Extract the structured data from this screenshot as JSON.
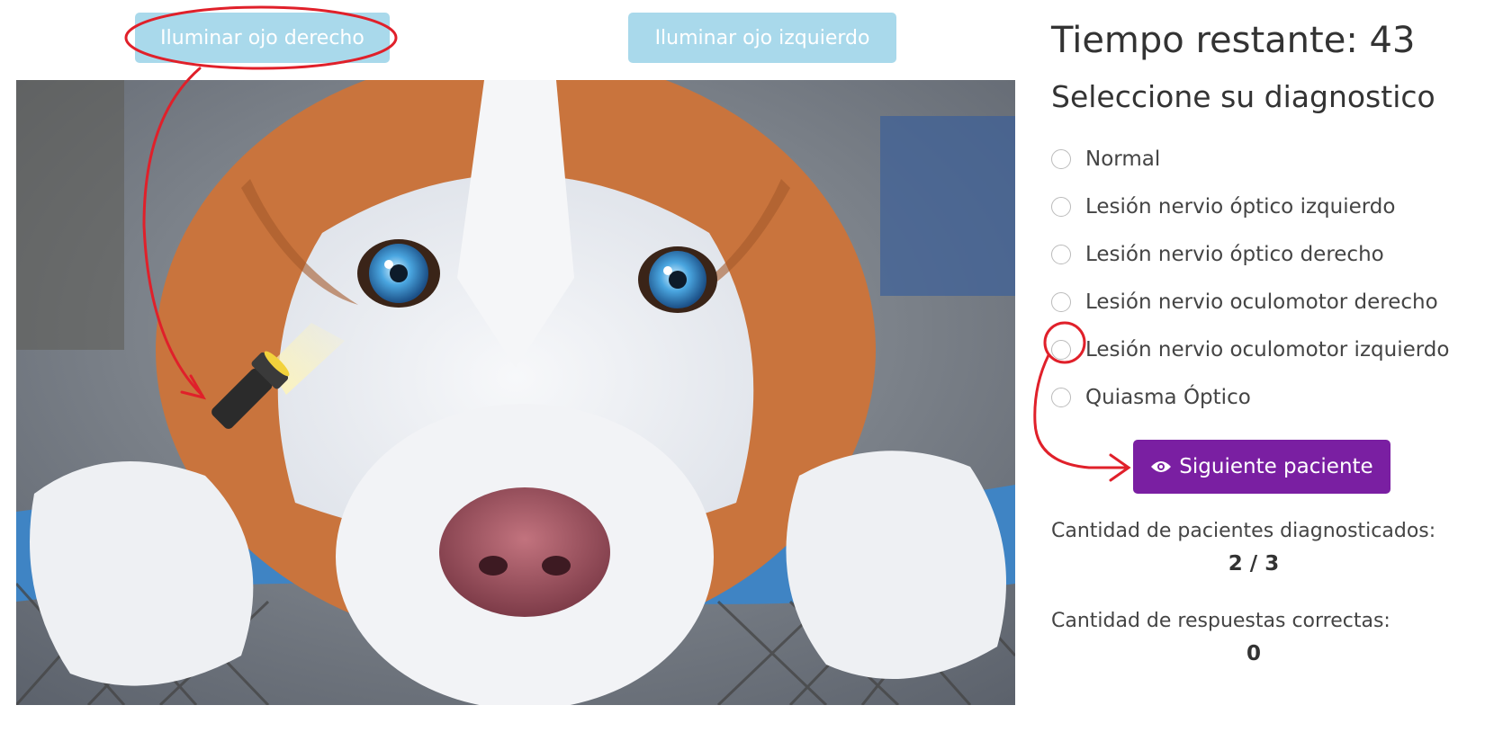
{
  "buttons": {
    "illuminate_right": "Iluminar ojo derecho",
    "illuminate_left": "Iluminar ojo izquierdo",
    "next_patient": "Siguiente paciente"
  },
  "timer": {
    "label": "Tiempo restante: 43"
  },
  "diagnosis": {
    "heading": "Seleccione su diagnostico",
    "options": [
      {
        "label": "Normal"
      },
      {
        "label": "Lesión nervio óptico izquierdo"
      },
      {
        "label": "Lesión nervio óptico derecho"
      },
      {
        "label": "Lesión nervio oculomotor derecho"
      },
      {
        "label": "Lesión nervio oculomotor izquierdo"
      },
      {
        "label": "Quiasma Óptico"
      }
    ]
  },
  "stats": {
    "diagnosed_label": "Cantidad de pacientes diagnosticados:",
    "diagnosed_value": "2 / 3",
    "correct_label": "Cantidad de respuestas correctas:",
    "correct_value": "0"
  },
  "colors": {
    "illuminate_button_bg": "#a9d9eb",
    "next_button_bg": "#7a1fa2",
    "annotation_red": "#e0202a"
  },
  "icons": {
    "next_button_icon": "eye-icon",
    "cursor_overlay": "flashlight-icon"
  }
}
